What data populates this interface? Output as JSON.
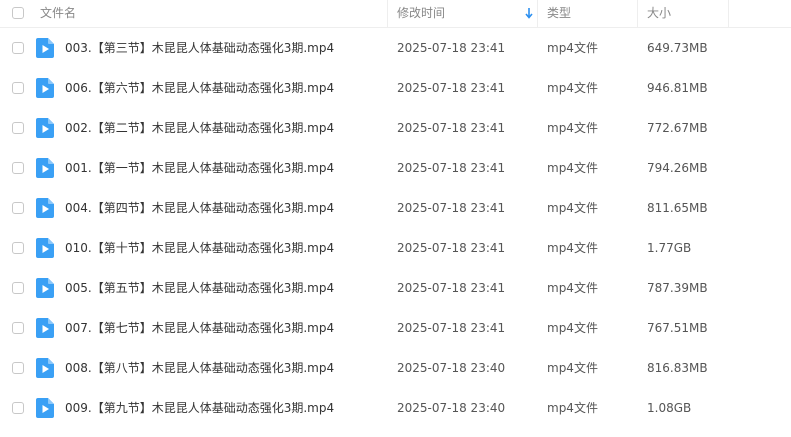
{
  "header": {
    "name": "文件名",
    "modified": "修改时间",
    "type": "类型",
    "size": "大小",
    "sort_column": "modified",
    "sort_direction": "descending"
  },
  "colors": {
    "accent": "#2b8ff0",
    "file_icon": "#3aa0f5",
    "text": "#333333",
    "muted": "#888888"
  },
  "files": [
    {
      "name": "003.【第三节】木昆昆人体基础动态强化3期.mp4",
      "modified": "2025-07-18 23:41",
      "type": "mp4文件",
      "size": "649.73MB",
      "icon": "video-file-icon"
    },
    {
      "name": "006.【第六节】木昆昆人体基础动态强化3期.mp4",
      "modified": "2025-07-18 23:41",
      "type": "mp4文件",
      "size": "946.81MB",
      "icon": "video-file-icon"
    },
    {
      "name": "002.【第二节】木昆昆人体基础动态强化3期.mp4",
      "modified": "2025-07-18 23:41",
      "type": "mp4文件",
      "size": "772.67MB",
      "icon": "video-file-icon"
    },
    {
      "name": "001.【第一节】木昆昆人体基础动态强化3期.mp4",
      "modified": "2025-07-18 23:41",
      "type": "mp4文件",
      "size": "794.26MB",
      "icon": "video-file-icon"
    },
    {
      "name": "004.【第四节】木昆昆人体基础动态强化3期.mp4",
      "modified": "2025-07-18 23:41",
      "type": "mp4文件",
      "size": "811.65MB",
      "icon": "video-file-icon"
    },
    {
      "name": "010.【第十节】木昆昆人体基础动态强化3期.mp4",
      "modified": "2025-07-18 23:41",
      "type": "mp4文件",
      "size": "1.77GB",
      "icon": "video-file-icon"
    },
    {
      "name": "005.【第五节】木昆昆人体基础动态强化3期.mp4",
      "modified": "2025-07-18 23:41",
      "type": "mp4文件",
      "size": "787.39MB",
      "icon": "video-file-icon"
    },
    {
      "name": "007.【第七节】木昆昆人体基础动态强化3期.mp4",
      "modified": "2025-07-18 23:41",
      "type": "mp4文件",
      "size": "767.51MB",
      "icon": "video-file-icon"
    },
    {
      "name": "008.【第八节】木昆昆人体基础动态强化3期.mp4",
      "modified": "2025-07-18 23:40",
      "type": "mp4文件",
      "size": "816.83MB",
      "icon": "video-file-icon"
    },
    {
      "name": "009.【第九节】木昆昆人体基础动态强化3期.mp4",
      "modified": "2025-07-18 23:40",
      "type": "mp4文件",
      "size": "1.08GB",
      "icon": "video-file-icon"
    }
  ]
}
